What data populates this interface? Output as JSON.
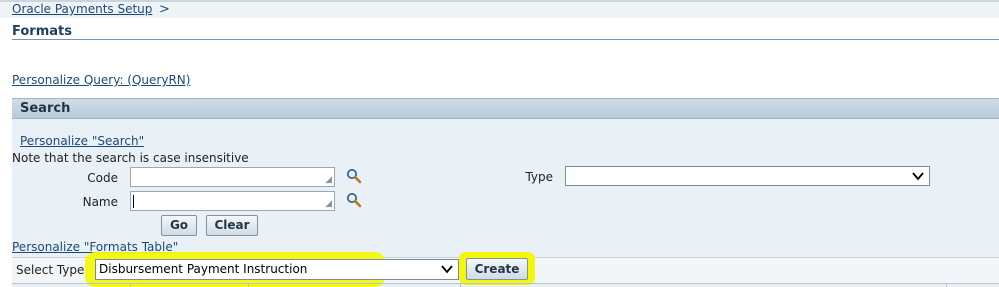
{
  "breadcrumb": {
    "item": "Oracle Payments Setup",
    "separator": ">"
  },
  "page": {
    "title": "Formats"
  },
  "links": {
    "personalize_query": "Personalize Query: (QueryRN)",
    "personalize_search": "Personalize \"Search\"",
    "personalize_table": "Personalize \"Formats Table\""
  },
  "search": {
    "title": "Search",
    "note": "Note that the search is case insensitive",
    "code_label": "Code",
    "name_label": "Name",
    "type_label": "Type",
    "code_value": "",
    "name_value": "",
    "type_value": "",
    "go_label": "Go",
    "clear_label": "Clear"
  },
  "table_controls": {
    "select_type_label": "Select Type",
    "select_type_value": "Disbursement Payment Instruction",
    "create_label": "Create"
  },
  "icons": {
    "search": "magnifying-glass-icon",
    "dropdown": "chevron-down-icon"
  },
  "colors": {
    "link": "#1c4a78",
    "header_bg": "#b8cbd9",
    "region_bg": "#eaf1f6",
    "highlight": "#f3f80a"
  }
}
